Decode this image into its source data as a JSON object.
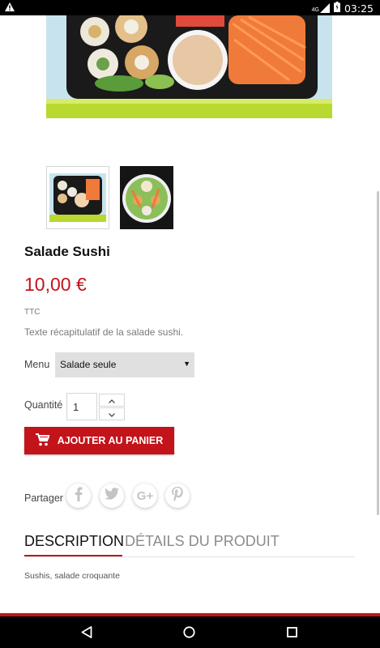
{
  "status_bar": {
    "network": "4G",
    "time": "03:25"
  },
  "product": {
    "title": "Salade Sushi",
    "price": "10,00 €",
    "tax_label": "TTC",
    "summary": "Texte récapitulatif de la salade sushi."
  },
  "menu": {
    "label": "Menu",
    "selected": "Salade seule"
  },
  "quantity": {
    "label": "Quantité",
    "value": "1"
  },
  "cart_button": {
    "label": "AJOUTER AU PANIER"
  },
  "share": {
    "label": "Partager",
    "networks": [
      "facebook-icon",
      "twitter-icon",
      "google-plus-icon",
      "pinterest-icon"
    ]
  },
  "tabs": [
    {
      "label": "DESCRIPTION",
      "active": true
    },
    {
      "label": "DÉTAILS DU PRODUIT",
      "active": false
    }
  ],
  "description": {
    "text": "Sushis, salade croquante"
  },
  "colors": {
    "accent": "#c3141b"
  }
}
